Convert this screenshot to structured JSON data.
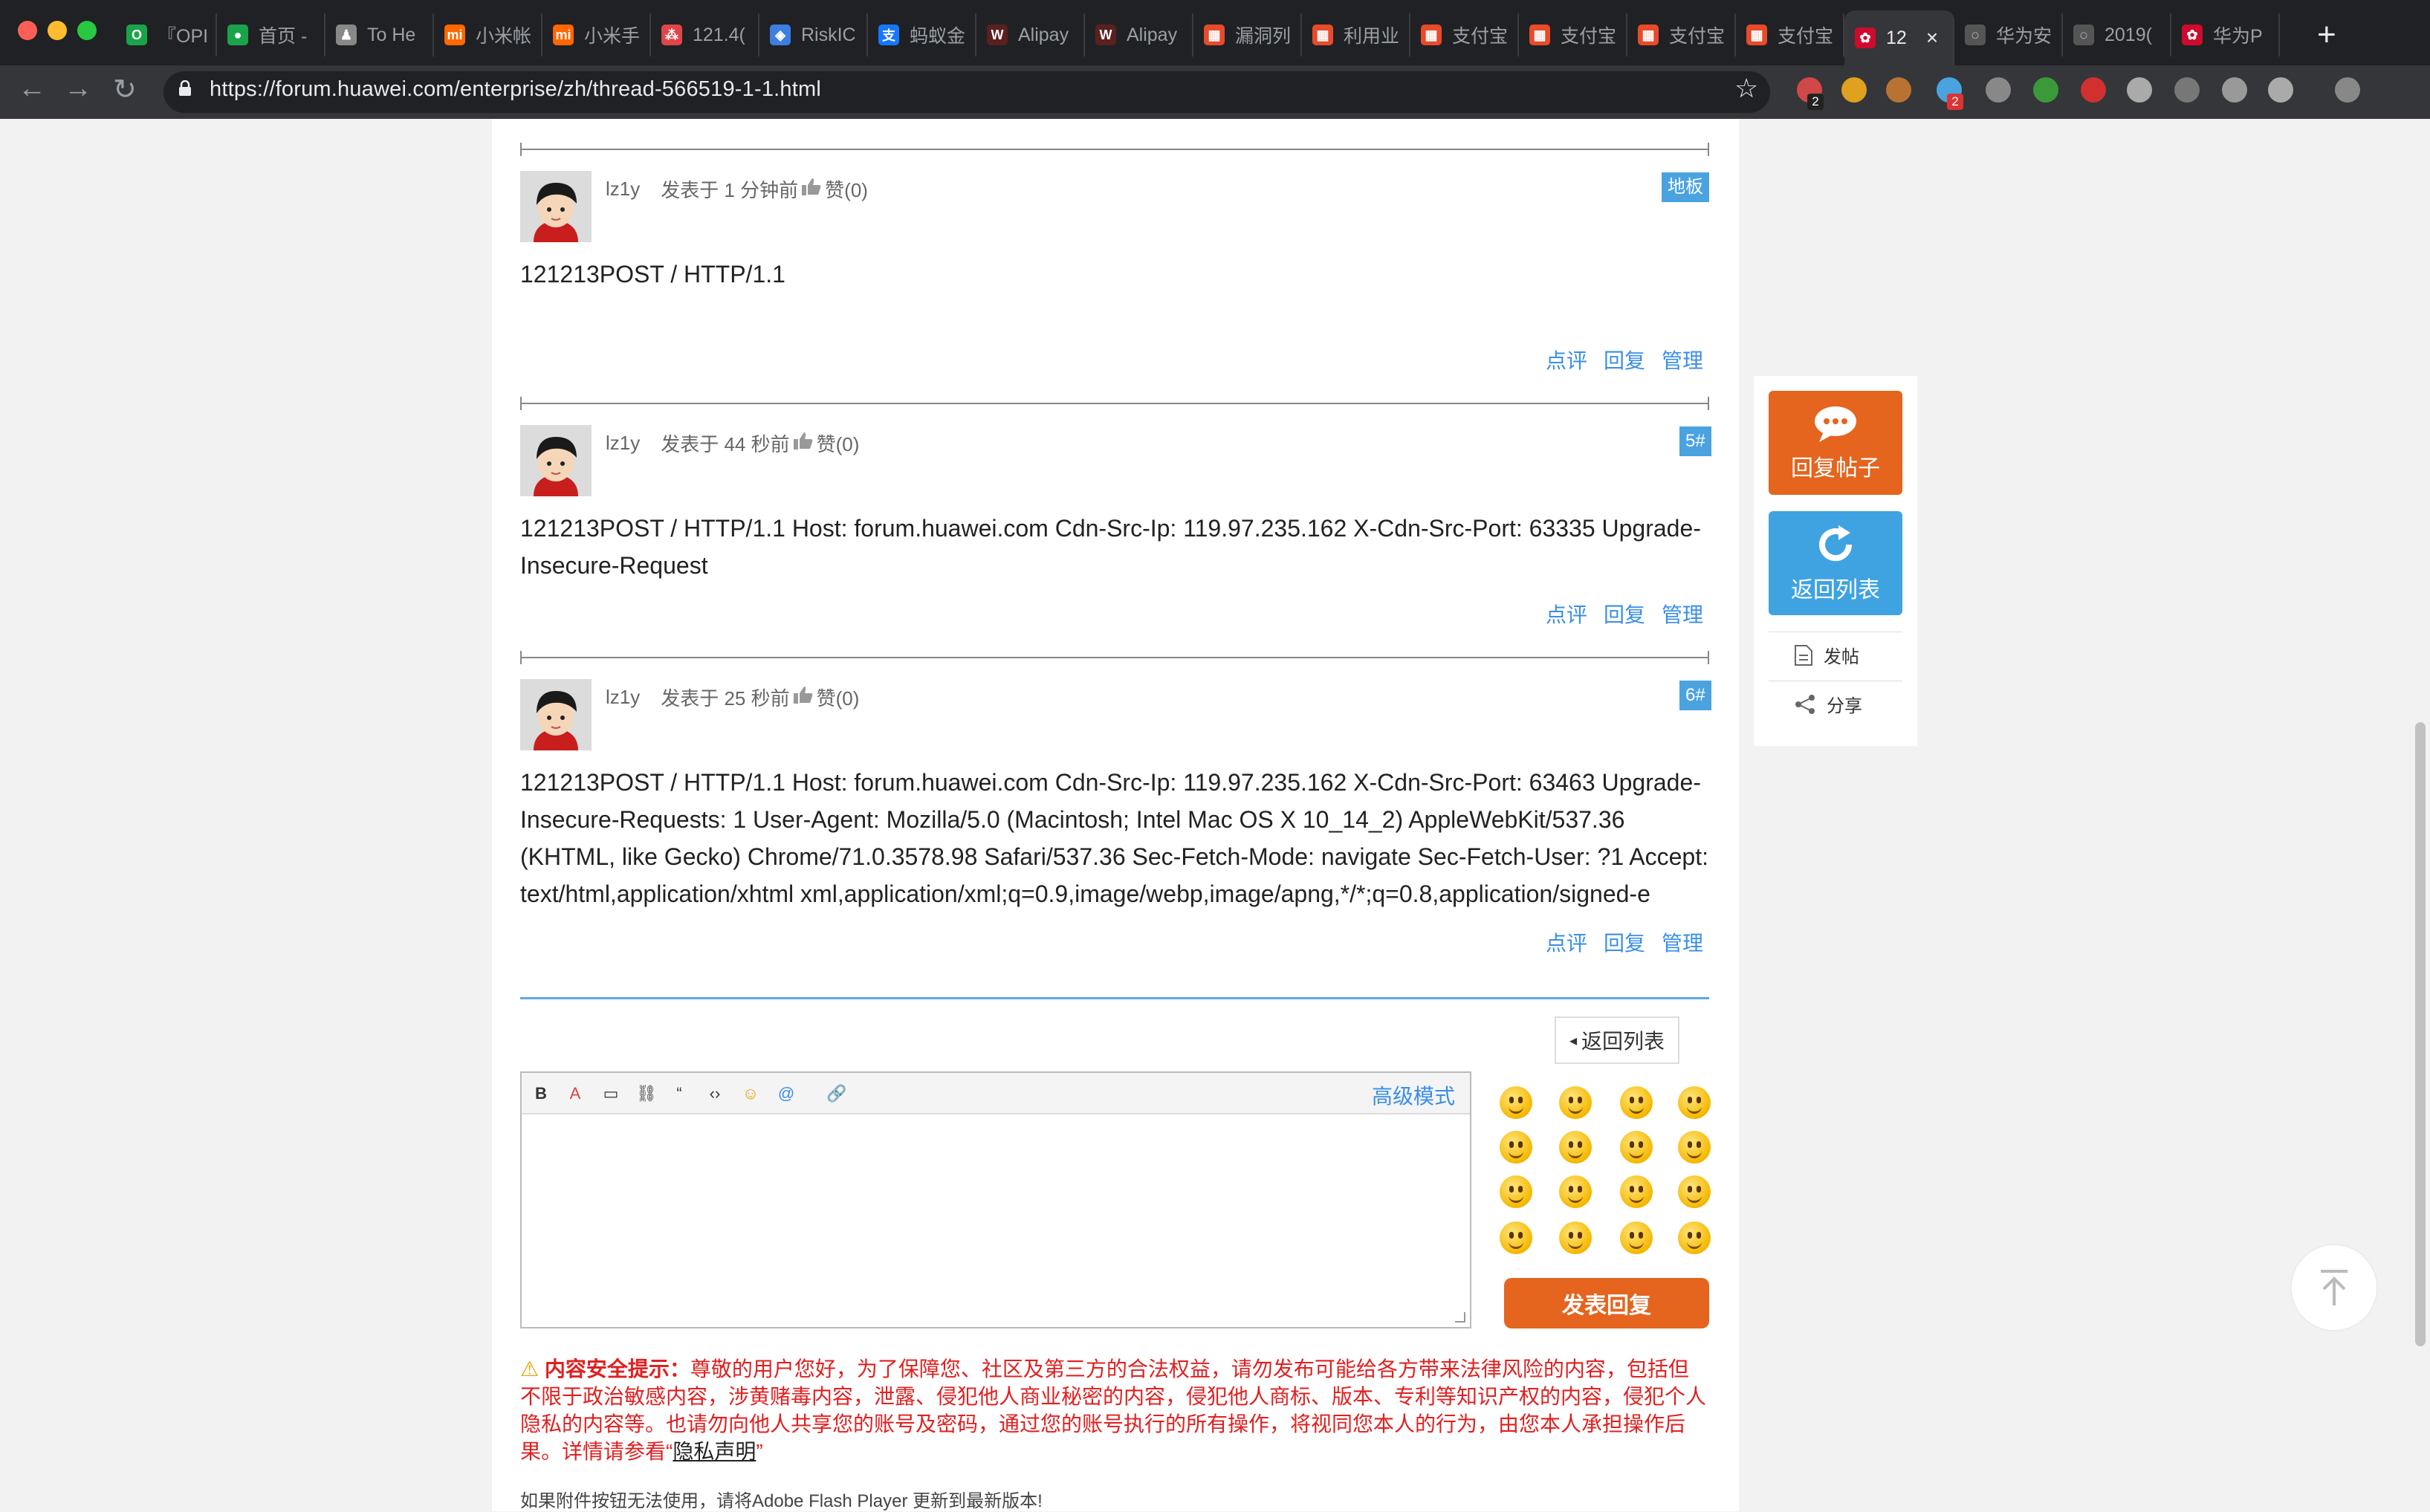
{
  "browser": {
    "tabs": [
      {
        "title": "『OPI",
        "fav_color": "#1aa34a",
        "glyph": "O"
      },
      {
        "title": "首页 -",
        "fav_color": "#1aa34a",
        "glyph": "●"
      },
      {
        "title": "To He",
        "fav_color": "#888888",
        "glyph": "♟"
      },
      {
        "title": "小米帐",
        "fav_color": "#ff6700",
        "glyph": "mi"
      },
      {
        "title": "小米手",
        "fav_color": "#ff6700",
        "glyph": "mi"
      },
      {
        "title": "121.4(",
        "fav_color": "#e0454a",
        "glyph": "⁂"
      },
      {
        "title": "RiskIC",
        "fav_color": "#3d7ee0",
        "glyph": "◈"
      },
      {
        "title": "蚂蚁金",
        "fav_color": "#1677ff",
        "glyph": "支"
      },
      {
        "title": "Alipay",
        "fav_color": "#5a1f1f",
        "glyph": "W"
      },
      {
        "title": "Alipay",
        "fav_color": "#5a1f1f",
        "glyph": "W"
      },
      {
        "title": "漏洞列",
        "fav_color": "#e84a2a",
        "glyph": "▦"
      },
      {
        "title": "利用业",
        "fav_color": "#e84a2a",
        "glyph": "▦"
      },
      {
        "title": "支付宝",
        "fav_color": "#e84a2a",
        "glyph": "▦"
      },
      {
        "title": "支付宝",
        "fav_color": "#e84a2a",
        "glyph": "▦"
      },
      {
        "title": "支付宝",
        "fav_color": "#e84a2a",
        "glyph": "▦"
      },
      {
        "title": "支付宝",
        "fav_color": "#e84a2a",
        "glyph": "▦"
      },
      {
        "title": "12",
        "fav_color": "#cf0a2c",
        "glyph": "✿",
        "active": true
      },
      {
        "title": "华为安",
        "fav_color": "#555555",
        "glyph": "◌"
      },
      {
        "title": "2019(",
        "fav_color": "#555555",
        "glyph": "◌"
      },
      {
        "title": "华为P",
        "fav_color": "#cf0a2c",
        "glyph": "✿"
      }
    ],
    "close_glyph": "×",
    "new_tab_glyph": "+",
    "url": "https://forum.huawei.com/enterprise/zh/thread-566519-1-1.html",
    "back_glyph": "←",
    "forward_glyph": "→",
    "reload_glyph": "↻",
    "star_glyph": "☆",
    "ext_badges": [
      "2",
      "2"
    ]
  },
  "posts": [
    {
      "user": "lz1y",
      "time": "发表于 1 分钟前",
      "likes": "赞(0)",
      "floor": "地板",
      "text": "121213POST / HTTP/1.1"
    },
    {
      "user": "lz1y",
      "time": "发表于 44 秒前",
      "likes": "赞(0)",
      "floor": "5#",
      "text": "121213POST / HTTP/1.1 Host: forum.huawei.com Cdn-Src-Ip: 119.97.235.162 X-Cdn-Src-Port: 63335 Upgrade-Insecure-Request"
    },
    {
      "user": "lz1y",
      "time": "发表于 25 秒前",
      "likes": "赞(0)",
      "floor": "6#",
      "text": "121213POST / HTTP/1.1 Host: forum.huawei.com Cdn-Src-Ip: 119.97.235.162 X-Cdn-Src-Port: 63463 Upgrade-Insecure-Requests: 1 User-Agent: Mozilla/5.0 (Macintosh; Intel Mac OS X 10_14_2) AppleWebKit/537.36 (KHTML, like Gecko) Chrome/71.0.3578.98 Safari/537.36 Sec-Fetch-Mode: navigate Sec-Fetch-User: ?1 Accept: text/html,application/xhtml xml,application/xml;q=0.9,image/webp,image/apng,*/*;q=0.8,application/signed-e"
    }
  ],
  "post_actions": {
    "comment": "点评",
    "reply": "回复",
    "manage": "管理"
  },
  "reply_area": {
    "back_to_list": "返回列表",
    "back_glyph": "◂",
    "advanced_mode": "高级模式",
    "toolbar_glyphs": [
      "B",
      "A",
      "▭",
      "⛓",
      "“",
      "‹›",
      "☺",
      "@",
      "🔗"
    ],
    "submit": "发表回复"
  },
  "notice": {
    "icon": "⚠",
    "title": "内容安全提示：",
    "body": "尊敬的用户您好，为了保障您、社区及第三方的合法权益，请勿发布可能给各方带来法律风险的内容，包括但不限于政治敏感内容，涉黄赌毒内容，泄露、侵犯他人商业秘密的内容，侵犯他人商标、版本、专利等知识产权的内容，侵犯个人隐私的内容等。也请勿向他人共享您的账号及密码，通过您的账号执行的所有操作，将视同您本人的行为，由您本人承担操作后果。详情请参看“",
    "link": "隐私声明",
    "tail": "”"
  },
  "flash_note": "如果附件按钮无法使用，请将Adobe Flash Player 更新到最新版本!",
  "sidebar": {
    "reply_post": "回复帖子",
    "back_list": "返回列表",
    "new_post": "发帖",
    "share": "分享",
    "reply_color": "#e5641e",
    "back_color": "#3fa3e2"
  },
  "colors": {
    "link_blue": "#3a8ee6",
    "floor_blue": "#4aa3df",
    "warning_red": "#e02020"
  }
}
